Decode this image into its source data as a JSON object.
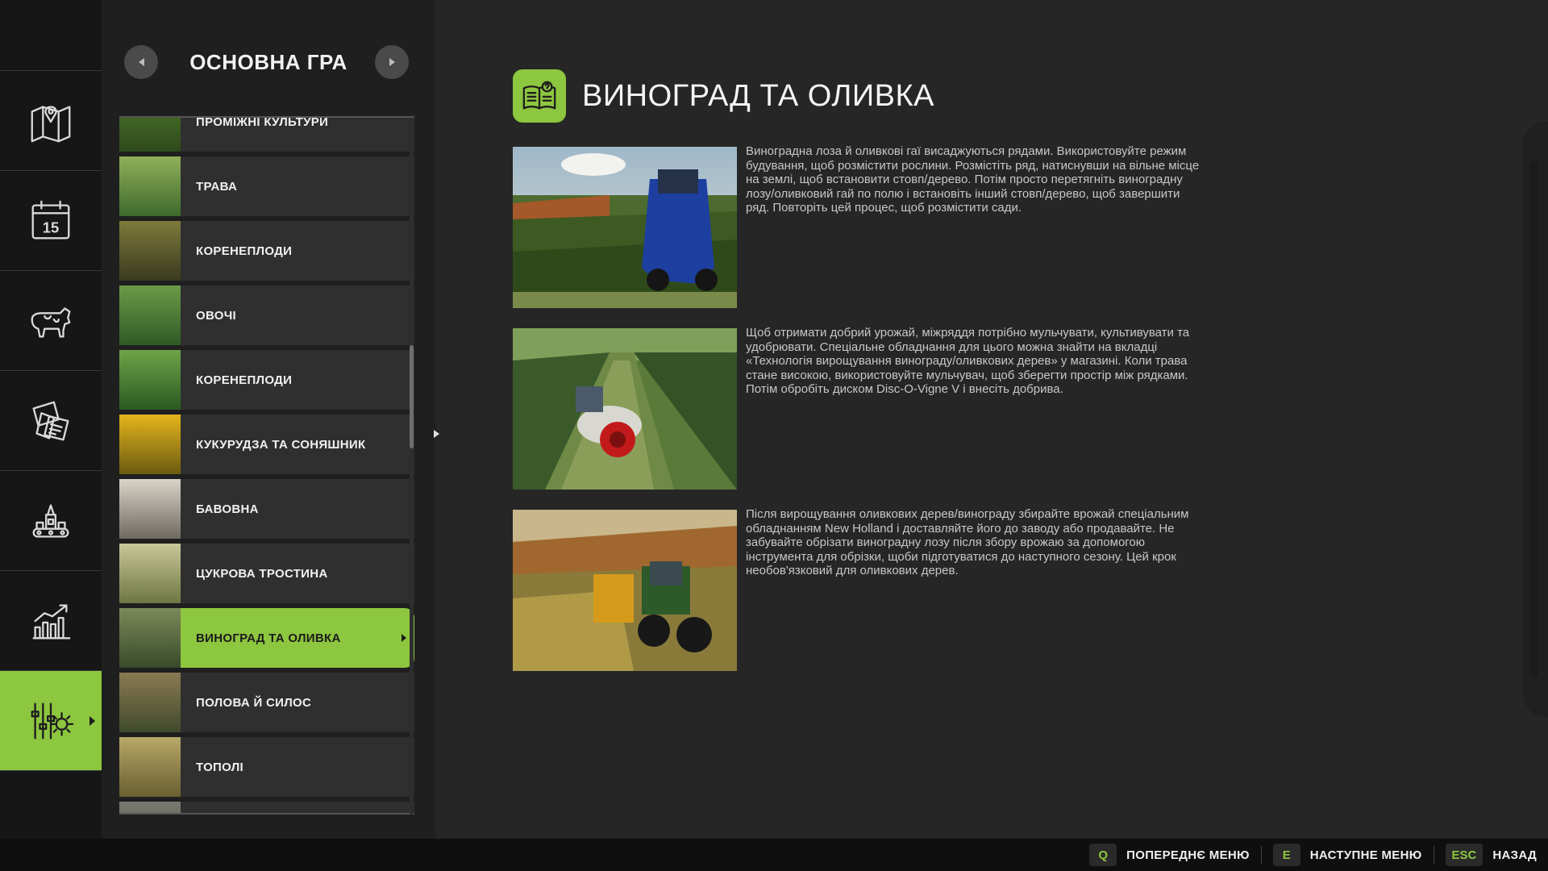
{
  "sidebar": {
    "items": [
      {
        "icon": "map-icon",
        "active": false
      },
      {
        "icon": "calendar-icon",
        "active": false,
        "text": "15"
      },
      {
        "icon": "cow-icon",
        "active": false
      },
      {
        "icon": "contracts-icon",
        "active": false
      },
      {
        "icon": "production-icon",
        "active": false
      },
      {
        "icon": "statistics-icon",
        "active": false
      },
      {
        "icon": "settings-icon",
        "active": true
      }
    ]
  },
  "category": {
    "title": "ОСНОВНА ГРА",
    "items": [
      {
        "label": "ПРОМІЖНІ КУЛЬТУРИ",
        "thumb": [
          "#2e4a1c",
          "#4f7a2a"
        ]
      },
      {
        "label": "ТРАВА",
        "thumb": [
          "#3f6a2c",
          "#8fb05a"
        ]
      },
      {
        "label": "КОРЕНЕПЛОДИ",
        "thumb": [
          "#3a3a20",
          "#7d7a3a"
        ]
      },
      {
        "label": "ОВОЧІ",
        "thumb": [
          "#2f5a26",
          "#6d9a48"
        ]
      },
      {
        "label": "КОРЕНЕПЛОДИ",
        "thumb": [
          "#2b5a22",
          "#6fa448"
        ]
      },
      {
        "label": "КУКУРУДЗА ТА СОНЯШНИК",
        "thumb": [
          "#6b5a10",
          "#e4b51c"
        ]
      },
      {
        "label": "БАВОВНА",
        "thumb": [
          "#6f6a62",
          "#d9d4c8"
        ]
      },
      {
        "label": "ЦУКРОВА ТРОСТИНА",
        "thumb": [
          "#6d7640",
          "#c8c898"
        ]
      },
      {
        "label": "ВИНОГРАД ТА ОЛИВКА",
        "thumb": [
          "#394a2a",
          "#7c8a5a"
        ],
        "active": true
      },
      {
        "label": "ПОЛОВА Й СИЛОС",
        "thumb": [
          "#3f4a2c",
          "#8a7a52"
        ]
      },
      {
        "label": "ТОПОЛІ",
        "thumb": [
          "#6a5e30",
          "#b8a868"
        ]
      },
      {
        "label": "",
        "thumb": [
          "#4a4a44",
          "#7a7a70"
        ]
      }
    ]
  },
  "content": {
    "title": "ВИНОГРАД ТА ОЛИВКА",
    "header_icon": "help-book-icon",
    "sections": [
      {
        "text": "Виноградна лоза й оливкові гаї висаджуються рядами. Використовуйте режим будування, щоб розмістити рослини. Розмістіть ряд, натиснувши на вільне місце на землі, щоб встановити стовп/дерево. Потім просто перетягніть виноградну лозу/оливковий гай по полю і встановіть інший стовп/дерево, щоб завершити ряд. Повторіть цей процес, щоб розмістити сади.",
        "image": "grape-harvester-image"
      },
      {
        "text": "Щоб отримати добрий урожай, міжряддя потрібно мульчувати, культивувати та удобрювати. Спеціальне обладнання для цього можна знайти на вкладці «Технологія вирощування винограду/оливкових дерев» у магазині. Коли трава стане високою, використовуйте мульчувач, щоб зберегти простір між рядками. Потім обробіть диском Disc-O-Vigne V і внесіть добрива.",
        "image": "vineyard-sprayer-image"
      },
      {
        "text": "Після вирощування оливкових дерев/винограду збирайте врожай спеціальним обладнанням New Holland і доставляйте його до заводу або продавайте. Не забувайте обрізати виноградну лозу після збору врожаю за допомогою інструмента для обрізки, щоби підготуватися до наступного сезону. Цей крок необов'язковий для оливкових дерев.",
        "image": "olive-tractor-image"
      }
    ]
  },
  "footer": {
    "hints": [
      {
        "key": "Q",
        "label": "ПОПЕРЕДНЄ МЕНЮ"
      },
      {
        "key": "E",
        "label": "НАСТУПНЕ МЕНЮ"
      },
      {
        "key": "ESC",
        "label": "НАЗАД"
      }
    ]
  },
  "colors": {
    "accent": "#8dc63f",
    "background": "#262626",
    "panel": "#1f1f1f",
    "rail": "#161616",
    "bottom_bar": "#0f0f0f"
  }
}
